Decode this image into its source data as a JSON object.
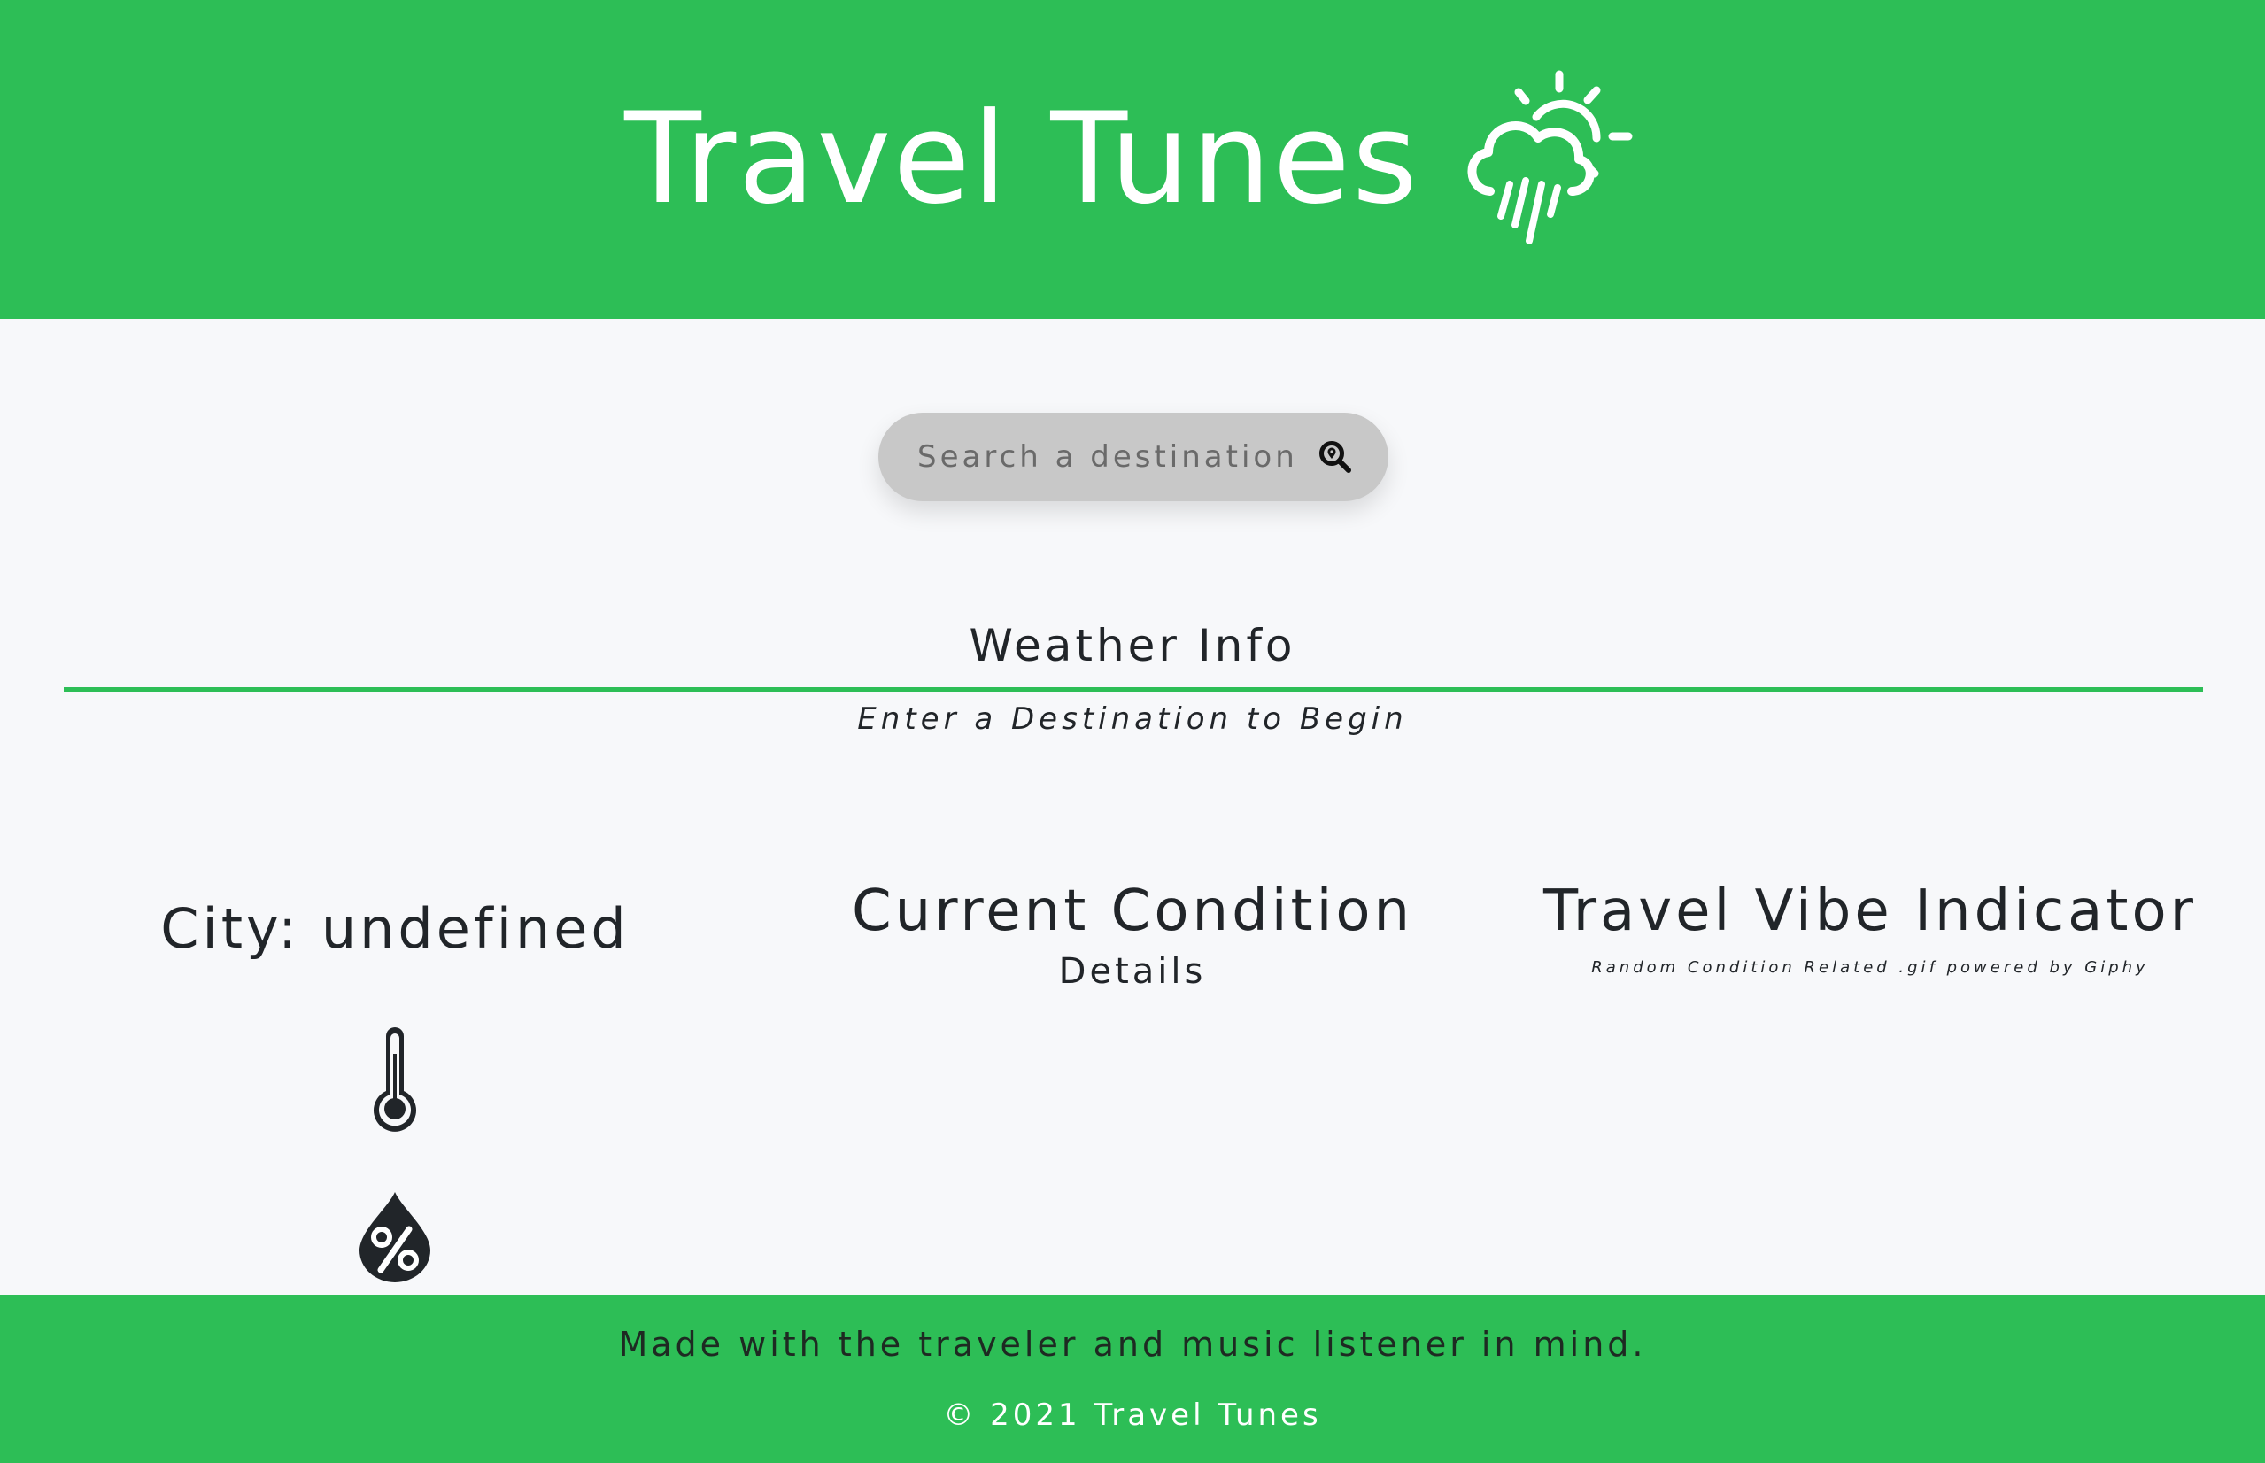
{
  "header": {
    "title": "Travel Tunes",
    "icon": "cloud-sun-rain-icon",
    "background": "#2dbe56"
  },
  "search": {
    "placeholder": "Search a destination",
    "value": "",
    "button_icon": "search-location-icon"
  },
  "weather": {
    "title": "Weather Info",
    "subtitle": "Enter a Destination to Begin",
    "accent": "#2dbe56"
  },
  "city": {
    "label": "City: undefined",
    "temp_icon": "thermometer-icon",
    "humidity_icon": "humidity-percent-drop-icon"
  },
  "condition": {
    "title": "Current Condition",
    "details": "Details"
  },
  "vibe": {
    "title": "Travel Vibe Indicator",
    "caption": "Random Condition Related .gif powered by Giphy"
  },
  "footer": {
    "text": "Made with the traveler and music listener in mind.",
    "copyright": "© 2021 Travel Tunes"
  }
}
